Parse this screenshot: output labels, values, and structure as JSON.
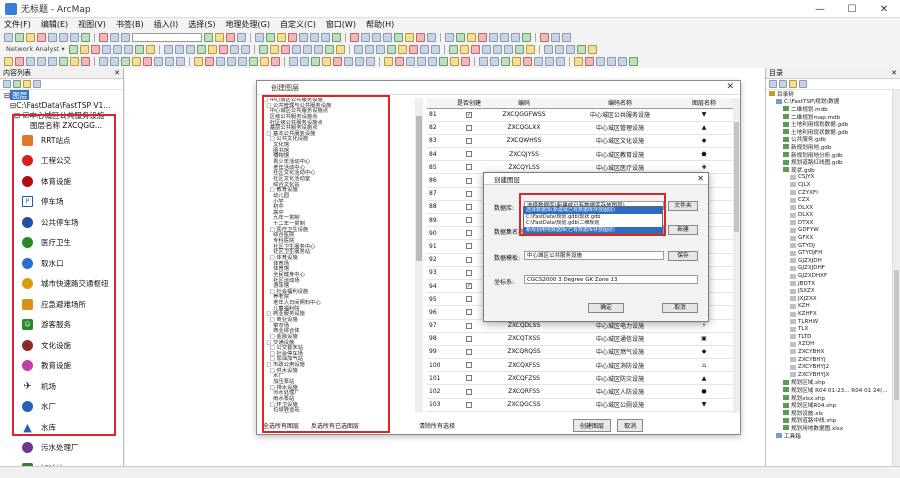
{
  "window": {
    "title": "无标题 - ArcMap",
    "buttons": [
      "—",
      "☐",
      "✕"
    ]
  },
  "menu": [
    "文件(F)",
    "编辑(E)",
    "视图(V)",
    "书签(B)",
    "插入(I)",
    "选择(S)",
    "地理处理(G)",
    "自定义(C)",
    "窗口(W)",
    "帮助(H)"
  ],
  "toolbar": {
    "network_label": "Network Analyst ▾"
  },
  "toc": {
    "header": "内容列表",
    "tree": [
      "图层",
      "C:\\FastData\\FastTSP V1...",
      "中心城区公共服务设施",
      "图层名称 ZXCQGG..."
    ],
    "legend": [
      {
        "label": "RRT站点",
        "color": "#e2762a",
        "icon": "square"
      },
      {
        "label": "工程公交",
        "color": "#d42020",
        "icon": "circle"
      },
      {
        "label": "体育设施",
        "color": "#b01010",
        "icon": "circle"
      },
      {
        "label": "停车场",
        "color": "#1d5ea8",
        "icon": "parking"
      },
      {
        "label": "公共停车场",
        "color": "#2050a0",
        "icon": "circle"
      },
      {
        "label": "医疗卫生",
        "color": "#2a8a2a",
        "icon": "circle"
      },
      {
        "label": "取水口",
        "color": "#2a70c8",
        "icon": "circle"
      },
      {
        "label": "城市快速路交通枢纽",
        "color": "#d89a10",
        "icon": "circle"
      },
      {
        "label": "应急避难场所",
        "color": "#d8921a",
        "icon": "square"
      },
      {
        "label": "游客服务",
        "color": "#2a8a2a",
        "icon": "person"
      },
      {
        "label": "文化设施",
        "color": "#8a2a2a",
        "icon": "circle"
      },
      {
        "label": "教育设施",
        "color": "#c040a0",
        "icon": "circle"
      },
      {
        "label": "机场",
        "color": "#333333",
        "icon": "plane"
      },
      {
        "label": "水厂",
        "color": "#2a5fb8",
        "icon": "circle"
      },
      {
        "label": "水库",
        "color": "#2a5fb8",
        "icon": "triangle"
      },
      {
        "label": "污水处理厂",
        "color": "#6a3a8a",
        "icon": "circle"
      },
      {
        "label": "加油站",
        "color": "#3a7a3a",
        "icon": "square"
      }
    ]
  },
  "catalog": {
    "rows": [
      {
        "indent": 0,
        "label": "目录树"
      },
      {
        "indent": 1,
        "label": "C:\\FastTSP\\规划\\数据"
      },
      {
        "indent": 2,
        "label": "二维规划.mdb"
      },
      {
        "indent": 2,
        "label": "二维规划map.mdb"
      },
      {
        "indent": 2,
        "label": "土地利用规划数据.gdb"
      },
      {
        "indent": 2,
        "label": "土地利用现状数据.gdb"
      },
      {
        "indent": 2,
        "label": "公共服务.gdb"
      },
      {
        "indent": 2,
        "label": "新规划用地.gdb"
      },
      {
        "indent": 2,
        "label": "新规划用地分析.gdb"
      },
      {
        "indent": 2,
        "label": "规划道路红线图.gdb"
      },
      {
        "indent": 2,
        "label": "现状.gdb"
      },
      {
        "indent": 3,
        "label": "CSJYX"
      },
      {
        "indent": 3,
        "label": "CJLX"
      },
      {
        "indent": 3,
        "label": "CZYXFI"
      },
      {
        "indent": 3,
        "label": "CZX"
      },
      {
        "indent": 3,
        "label": "DLXX"
      },
      {
        "indent": 3,
        "label": "DLXX"
      },
      {
        "indent": 3,
        "label": "DTXX"
      },
      {
        "indent": 3,
        "label": "GDFYW"
      },
      {
        "indent": 3,
        "label": "GFXX"
      },
      {
        "indent": 3,
        "label": "GTYDJ"
      },
      {
        "indent": 3,
        "label": "GTYDJFH"
      },
      {
        "indent": 3,
        "label": "GJZXJDH"
      },
      {
        "indent": 3,
        "label": "GJZXJDHF"
      },
      {
        "indent": 3,
        "label": "GJZXDHXF"
      },
      {
        "indent": 3,
        "label": "JBDTX"
      },
      {
        "indent": 3,
        "label": "JSXZX"
      },
      {
        "indent": 3,
        "label": "JXJZXX"
      },
      {
        "indent": 3,
        "label": "KZH"
      },
      {
        "indent": 3,
        "label": "KZHFX"
      },
      {
        "indent": 3,
        "label": "TLRHW"
      },
      {
        "indent": 3,
        "label": "TLX"
      },
      {
        "indent": 3,
        "label": "TLTD"
      },
      {
        "indent": 3,
        "label": "XZQH"
      },
      {
        "indent": 3,
        "label": "ZXCYBHX"
      },
      {
        "indent": 3,
        "label": "ZXCYBHYJ"
      },
      {
        "indent": 3,
        "label": "ZXCYBHYJ2"
      },
      {
        "indent": 3,
        "label": "ZXCYBHYJX"
      },
      {
        "indent": 2,
        "label": "规划区域.shp"
      },
      {
        "indent": 2,
        "label": "规划区域 R04 01-23... R04 01 24(..."
      },
      {
        "indent": 2,
        "label": "规划xlsx.shp"
      },
      {
        "indent": 2,
        "label": "规划区域R04.shp"
      },
      {
        "indent": 2,
        "label": "规划设施.xls"
      },
      {
        "indent": 2,
        "label": "规划道路中线.shp"
      },
      {
        "indent": 2,
        "label": "规划用地数据图.xlsx"
      },
      {
        "indent": 1,
        "label": "工具箱"
      }
    ]
  },
  "dialog": {
    "title": "创建图层",
    "tree": [
      "□ 中心城区公共服务设施",
      "  □ 公共管理与公共服务设施",
      "    中心城区公共服务设施点",
      "    区级公共服务设施点",
      "    社区级公共服务设施点",
      "    基层公共服务设施点",
      "  □ 基本公共服务设施",
      "    □ 公共文化设施",
      "      文化馆",
      "      图书馆",
      "      博物馆",
      "      青少年活动中心",
      "      老年活动中心",
      "      社区文化活动中心",
      "      社区文化活动室",
      "      综合文化站",
      "    □ 教育设施",
      "      幼儿园",
      "      小学",
      "      初中",
      "      高中",
      "      九年一贯制",
      "      十二年一贯制",
      "    □ 医疗卫生设施",
      "      综合医院",
      "      专科医院",
      "      社区卫生服务中心",
      "      社区卫生服务站",
      "    □ 体育设施",
      "      体育场",
      "      体育馆",
      "      全民健身中心",
      "      社区运动场",
      "      游泳馆",
      "    □ 社会福利设施",
      "      养老院",
      "      老年人日间照料中心",
      "      儿童福利院",
      "  □ 商业服务设施",
      "    □ 商业设施",
      "      菜市场",
      "      商业综合体",
      "    □ 金融设施",
      "  □ 交通设施",
      "    □ 公交首末站",
      "    □ 社会停车场",
      "    □ 加油加气站",
      "  □ 市政公用设施",
      "    □ 供水设施",
      "      水厂",
      "      加压泵站",
      "    □ 排水设施",
      "      污水处理厂",
      "      雨水泵站",
      "    □ 环卫设施",
      "      垃圾转运站",
      "      公共厕所"
    ],
    "table_headers": [
      "是否创建",
      "编码",
      "编码名称",
      "图层名称"
    ],
    "table_rows": [
      {
        "n": "81",
        "checked": true,
        "code": "ZXCQGGFWSS",
        "name": "中心城区公共服务设施",
        "sym": "▼"
      },
      {
        "n": "82",
        "checked": false,
        "code": "ZXCQGLXX",
        "name": "中心城区管理设施",
        "sym": "▲"
      },
      {
        "n": "83",
        "checked": false,
        "code": "ZXCQWHSS",
        "name": "中心城区文化设施",
        "sym": "◆"
      },
      {
        "n": "84",
        "checked": false,
        "code": "ZXCQJYSS",
        "name": "中心城区教育设施",
        "sym": "⬟"
      },
      {
        "n": "85",
        "checked": false,
        "code": "ZXCQYLSS",
        "name": "中心城区医疗设施",
        "sym": "✚"
      },
      {
        "n": "86",
        "checked": false,
        "code": "ZXCQTYSS",
        "name": "中心城区体育设施",
        "sym": "◉"
      },
      {
        "n": "87",
        "checked": false,
        "code": "ZXCQFLSS",
        "name": "中心城区福利设施",
        "sym": "●"
      },
      {
        "n": "88",
        "checked": false,
        "code": "ZXCQSYSS",
        "name": "中心城区商业设施",
        "sym": "▣"
      },
      {
        "n": "89",
        "checked": false,
        "code": "ZXCQJRSS",
        "name": "中心城区金融设施",
        "sym": "◈"
      },
      {
        "n": "90",
        "checked": false,
        "code": "ZXCQJTSS",
        "name": "中心城区交通设施",
        "sym": "▲"
      },
      {
        "n": "91",
        "checked": false,
        "code": "ZXCQGJSS",
        "name": "中心城区公交设施",
        "sym": "●"
      },
      {
        "n": "92",
        "checked": false,
        "code": "ZXCQTCSS",
        "name": "中心城区停车设施",
        "sym": "▼"
      },
      {
        "n": "93",
        "checked": false,
        "code": "ZXCQJYQZ",
        "name": "中心城区加油设施",
        "sym": "◆"
      },
      {
        "n": "94",
        "checked": true,
        "code": "ZXCQGSSS",
        "name": "中心城区供水设施",
        "sym": "⬣"
      },
      {
        "n": "95",
        "checked": false,
        "code": "ZXCQPSSS",
        "name": "中心城区排水设施",
        "sym": "▲"
      },
      {
        "n": "96",
        "checked": false,
        "code": "ZXCQHWSS",
        "name": "中心城区环卫设施",
        "sym": "◉"
      },
      {
        "n": "97",
        "checked": false,
        "code": "ZXCQDLSS",
        "name": "中心城区电力设施",
        "sym": "⚡"
      },
      {
        "n": "98",
        "checked": false,
        "code": "ZXCQTXSS",
        "name": "中心城区通信设施",
        "sym": "▣"
      },
      {
        "n": "99",
        "checked": false,
        "code": "ZXCQRQSS",
        "name": "中心城区燃气设施",
        "sym": "◆"
      },
      {
        "n": "100",
        "checked": false,
        "code": "ZXCQXFSS",
        "name": "中心城区消防设施",
        "sym": "⌂"
      },
      {
        "n": "101",
        "checked": false,
        "code": "ZXCQFZSS",
        "name": "中心城区防灾设施",
        "sym": "▲"
      },
      {
        "n": "102",
        "checked": false,
        "code": "ZXCQRFSS",
        "name": "中心城区人防设施",
        "sym": "●"
      },
      {
        "n": "103",
        "checked": false,
        "code": "ZXCQGCSS",
        "name": "中心城区公厕设施",
        "sym": "▼"
      },
      {
        "n": "104",
        "checked": false,
        "code": "ZXCQLJSS",
        "name": "中心城区垃圾设施",
        "sym": "◆"
      }
    ],
    "bottom": {
      "select_all": "全选所有图层",
      "invert": "反选所有已选图层",
      "clear": "清除所有选择",
      "create": "创建图层",
      "cancel": "取消"
    }
  },
  "small_dialog": {
    "title": "创建图层",
    "label_folder": "数据库:",
    "value_folder": "选择数据库(新建或已有数据库存放图层)",
    "btn_browse": "文件夹",
    "label_name": "数据集名称:",
    "btn_new": "新建",
    "label_template": "数据模板:",
    "value_template": "中心城区公共服务设施",
    "btn_save": "保存",
    "label_crs": "坐标系:",
    "value_crs": "CGCS2000 3 Degree GK Zone 13",
    "ok": "确定",
    "cancel": "取消",
    "dropdown": [
      "选择数据库(新建或已有数据库存放图层)",
      "C:\\FastData\\规划.gdb\\现状.gdb",
      "C:\\FastData\\规划.gdb\\二维规划",
      "新规划用地数据库(已有数据库存放图层)"
    ]
  }
}
